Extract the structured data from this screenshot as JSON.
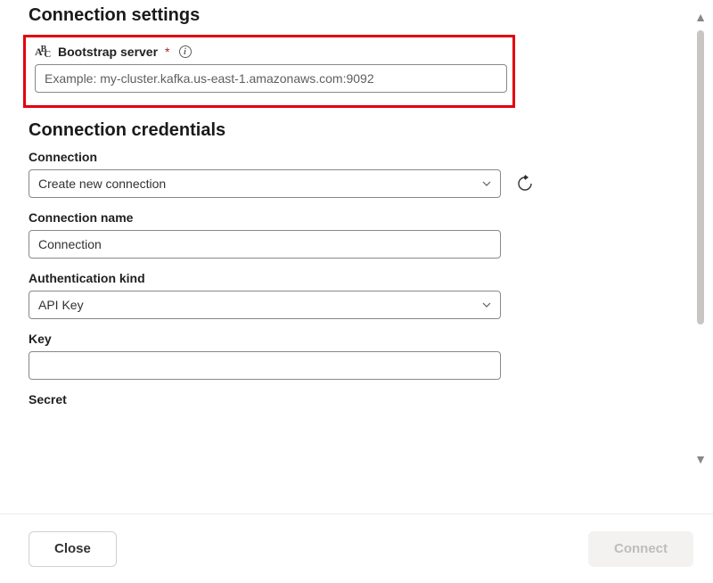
{
  "sections": {
    "settings_heading": "Connection settings",
    "credentials_heading": "Connection credentials"
  },
  "bootstrap": {
    "label": "Bootstrap server",
    "required_mark": "*",
    "placeholder": "Example: my-cluster.kafka.us-east-1.amazonaws.com:9092",
    "value": ""
  },
  "connection_select": {
    "label": "Connection",
    "selected": "Create new connection"
  },
  "connection_name": {
    "label": "Connection name",
    "value": "Connection"
  },
  "auth_kind": {
    "label": "Authentication kind",
    "selected": "API Key"
  },
  "key_field": {
    "label": "Key",
    "value": ""
  },
  "secret_field": {
    "label": "Secret"
  },
  "footer": {
    "close": "Close",
    "connect": "Connect"
  }
}
